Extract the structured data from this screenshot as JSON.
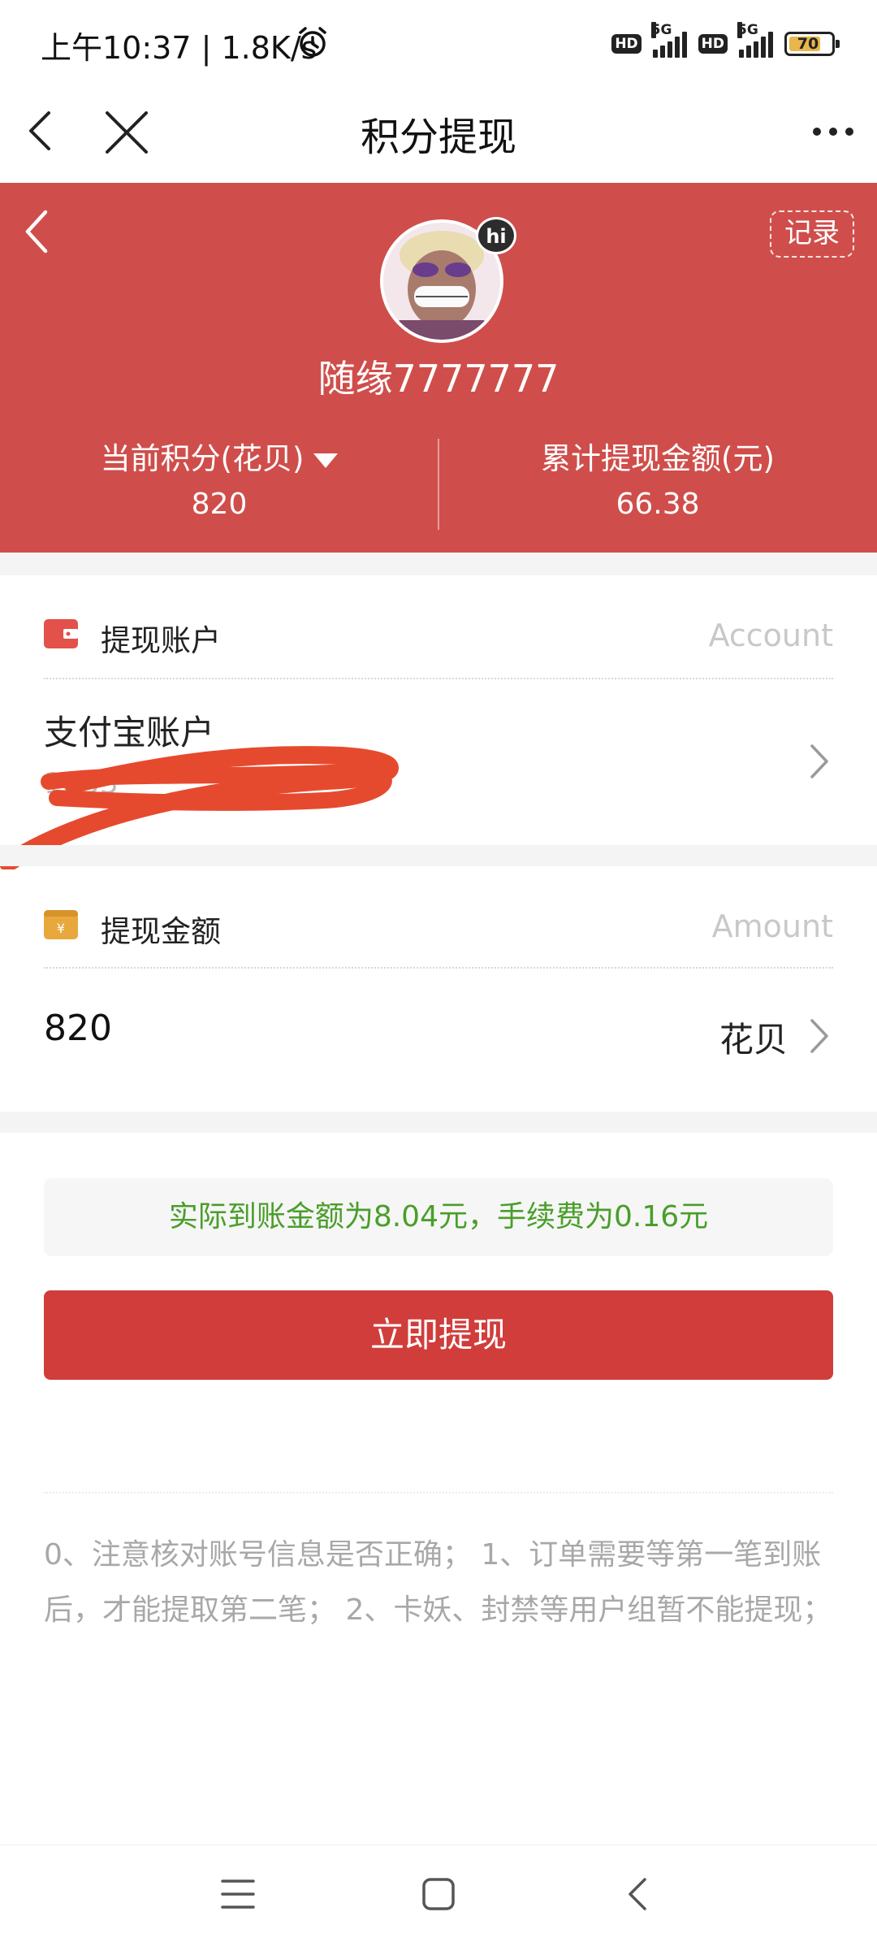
{
  "status_bar": {
    "time_speed": "上午10:37 | 1.8K/s",
    "hd1": "HD",
    "net1": "5G",
    "hd2": "HD",
    "net2": "5G",
    "battery": "70"
  },
  "nav": {
    "title": "积分提现"
  },
  "header": {
    "record_label": "记录",
    "avatar_badge": "hi",
    "username": "随缘7777777",
    "points_label": "当前积分(花贝)",
    "points_value": "820",
    "total_label": "累计提现金额(元)",
    "total_value": "66.38",
    "bg_color": "#cf4e4b"
  },
  "account_section": {
    "title": "提现账户",
    "en_label": "Account",
    "account_type": "支付宝账户",
    "account_number_visible": "1833",
    "icon": "wallet-icon"
  },
  "amount_section": {
    "title": "提现金额",
    "en_label": "Amount",
    "amount_value": "820",
    "unit": "花贝",
    "icon": "yen-icon"
  },
  "notice": {
    "text": "实际到账金额为8.04元，手续费为0.16元",
    "color": "#4a9e2a"
  },
  "submit": {
    "label": "立即提现",
    "color": "#d03d3b"
  },
  "tips": {
    "text": "0、注意核对账号信息是否正确； 1、订单需要等第一笔到账后，才能提取第二笔； 2、卡妖、封禁等用户组暂不能提现；"
  }
}
